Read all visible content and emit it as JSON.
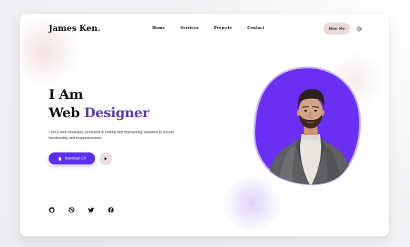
{
  "brand": {
    "name": "James Ken."
  },
  "nav": {
    "items": [
      {
        "label": "Home"
      },
      {
        "label": "Services"
      },
      {
        "label": "Projects"
      },
      {
        "label": "Contact"
      }
    ],
    "hire_label": "Hire Me",
    "theme_icon": "sun-icon"
  },
  "hero": {
    "line1": "I Am",
    "line2_prefix": "Web ",
    "line2_accent": "Designer",
    "description": "I am a web developer, proficient in coding and maintaining websites to ensure functionality and responsiveness.",
    "download_label": "Download CV",
    "download_icon": "file-icon",
    "play_icon": "play-icon"
  },
  "socials": [
    {
      "icon": "github-icon"
    },
    {
      "icon": "dribbble-icon"
    },
    {
      "icon": "twitter-icon"
    },
    {
      "icon": "facebook-icon"
    }
  ],
  "colors": {
    "accent": "#5b3fa8",
    "button_primary": "#5b2ff0",
    "hire_bg": "#ead9d9",
    "portrait_bg": "#6a2ff2"
  }
}
